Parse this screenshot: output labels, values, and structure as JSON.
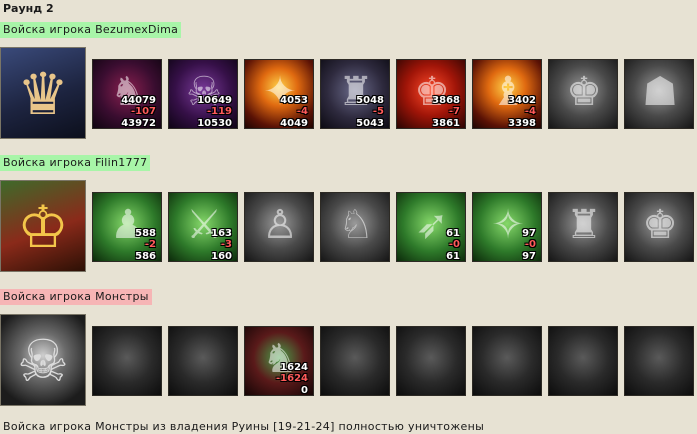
{
  "round_title": "Раунд 2",
  "footer_text": "Войска игрока Монстры из владения Руины [19-21-24] полностью уничтожены",
  "colors": {
    "ally_label_bg": "#a8f5a8",
    "enemy_label_bg": "#f6b5b5",
    "loss_text": "#ff5a5a",
    "page_bg": "#e7e2d3"
  },
  "armies": [
    {
      "label": "Войска игрока BezumexDima",
      "hero_icon": "knight-hero-portrait",
      "units": [
        {
          "icon": "dragon-unit-icon",
          "count": "44079",
          "loss": "-107",
          "remain": "43972"
        },
        {
          "icon": "skeleton-mage-unit-icon",
          "count": "10649",
          "loss": "-119",
          "remain": "10530"
        },
        {
          "icon": "fire-elemental-unit-icon",
          "count": "4053",
          "loss": "-4",
          "remain": "4049"
        },
        {
          "icon": "devil-unit-icon",
          "count": "5048",
          "loss": "-5",
          "remain": "5043"
        },
        {
          "icon": "pit-fiend-unit-icon",
          "count": "3868",
          "loss": "-7",
          "remain": "3861"
        },
        {
          "icon": "efreet-unit-icon",
          "count": "3402",
          "loss": "-4",
          "remain": "3398"
        },
        {
          "icon": "stone-demon-unit-icon",
          "count": "",
          "loss": "",
          "remain": ""
        },
        {
          "icon": "wraith-unit-icon",
          "count": "",
          "loss": "",
          "remain": ""
        }
      ]
    },
    {
      "label": "Войска игрока Filin1777",
      "hero_icon": "musketeer-hero-portrait",
      "units": [
        {
          "icon": "dwarf-warrior-unit-icon",
          "count": "588",
          "loss": "-2",
          "remain": "586"
        },
        {
          "icon": "armored-knight-unit-icon",
          "count": "163",
          "loss": "-3",
          "remain": "160"
        },
        {
          "icon": "spearman-unit-icon",
          "count": "",
          "loss": "",
          "remain": ""
        },
        {
          "icon": "griffin-unit-icon",
          "count": "",
          "loss": "",
          "remain": ""
        },
        {
          "icon": "elf-archer-unit-icon",
          "count": "61",
          "loss": "-0",
          "remain": "61"
        },
        {
          "icon": "druid-unit-icon",
          "count": "97",
          "loss": "-0",
          "remain": "97"
        },
        {
          "icon": "golem-unit-icon",
          "count": "",
          "loss": "",
          "remain": ""
        },
        {
          "icon": "titan-unit-icon",
          "count": "",
          "loss": "",
          "remain": ""
        }
      ]
    },
    {
      "label": "Войска игрока Монстры",
      "hero_icon": "skull-emblem-portrait",
      "units": [
        {
          "icon": "empty-slot-icon",
          "count": "",
          "loss": "",
          "remain": ""
        },
        {
          "icon": "empty-slot-icon",
          "count": "",
          "loss": "",
          "remain": ""
        },
        {
          "icon": "orc-warrior-unit-icon",
          "count": "1624",
          "loss": "-1624",
          "remain": "0"
        },
        {
          "icon": "empty-slot-icon",
          "count": "",
          "loss": "",
          "remain": ""
        },
        {
          "icon": "empty-slot-icon",
          "count": "",
          "loss": "",
          "remain": ""
        },
        {
          "icon": "empty-slot-icon",
          "count": "",
          "loss": "",
          "remain": ""
        },
        {
          "icon": "empty-slot-icon",
          "count": "",
          "loss": "",
          "remain": ""
        },
        {
          "icon": "empty-slot-icon",
          "count": "",
          "loss": "",
          "remain": ""
        }
      ]
    }
  ]
}
